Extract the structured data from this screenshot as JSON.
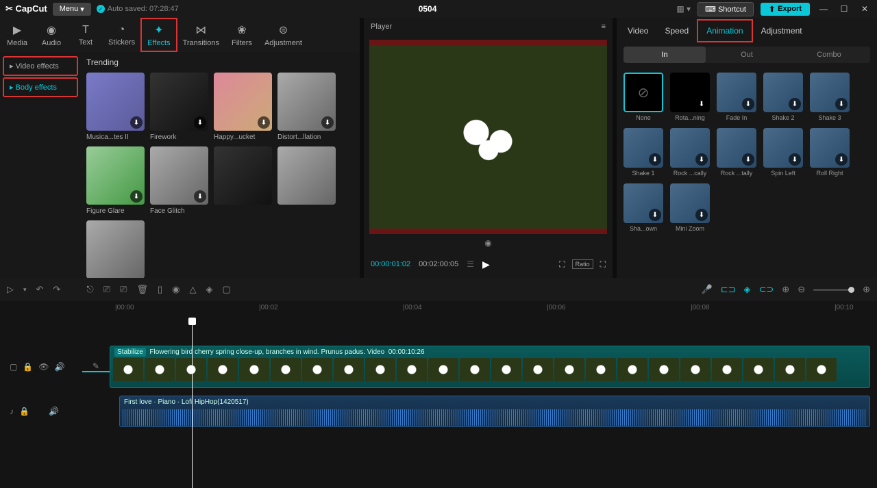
{
  "titlebar": {
    "logo": "✂ CapCut",
    "menu": "Menu",
    "autosave": "Auto saved: 07:28:47",
    "title": "0504",
    "shortcut": "Shortcut",
    "export": "Export"
  },
  "tabs": [
    "Media",
    "Audio",
    "Text",
    "Stickers",
    "Effects",
    "Transitions",
    "Filters",
    "Adjustment"
  ],
  "sidebar": {
    "video": "▸ Video effects",
    "body": "▸ Body effects"
  },
  "section": "Trending",
  "effects": [
    {
      "name": "Musica...tes II"
    },
    {
      "name": "Firework"
    },
    {
      "name": "Happy...ucket"
    },
    {
      "name": "Distort...llation"
    },
    {
      "name": "Figure Glare"
    },
    {
      "name": "Face Glitch"
    }
  ],
  "player": {
    "label": "Player",
    "time": "00:00:01:02",
    "dur": "00:02:00:05",
    "ratio": "Ratio"
  },
  "rtabs": [
    "Video",
    "Speed",
    "Animation",
    "Adjustment"
  ],
  "subtabs": [
    "In",
    "Out",
    "Combo"
  ],
  "anims": [
    {
      "name": "None"
    },
    {
      "name": "Rota...ning"
    },
    {
      "name": "Fade In"
    },
    {
      "name": "Shake 2"
    },
    {
      "name": "Shake 3"
    },
    {
      "name": "Shake 1"
    },
    {
      "name": "Rock ...cally"
    },
    {
      "name": "Rock ...tally"
    },
    {
      "name": "Spin Left"
    },
    {
      "name": "Roll Right"
    },
    {
      "name": "Sha...own"
    },
    {
      "name": "Mini Zoom"
    }
  ],
  "ruler": [
    "|00:00",
    "|00:02",
    "|00:04",
    "|00:06",
    "|00:08",
    "|00:10"
  ],
  "videoClip": {
    "stab": "Stabilize",
    "name": "Flowering bird cherry spring close-up, branches in wind. Prunus padus. Video",
    "dur": "00:00:10:26"
  },
  "audioClip": {
    "name": "First love · Piano · Lofi HipHop(1420517)"
  }
}
